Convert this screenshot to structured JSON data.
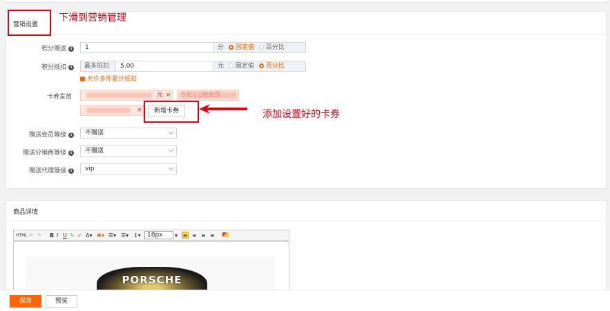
{
  "section": {
    "title": "营销设置",
    "annotation_scroll": "下滑到营销管理"
  },
  "points_gift": {
    "label": "积分赠送",
    "value": "1",
    "unit": "分",
    "opt_fixed": "固定值",
    "opt_percent": "百分比",
    "selected": "固定值"
  },
  "points_deduct": {
    "label": "积分抵扣",
    "prefix": "最多抵扣",
    "value": "5.00",
    "unit": "元",
    "opt_fixed": "固定值",
    "opt_percent": "百分比",
    "selected": "百分比",
    "checkbox_label": "允许多件累计抵扣"
  },
  "coupon": {
    "label": "卡券发放",
    "chip1_suffix": "元",
    "chip2_text": "5元 | 1级会员",
    "add_button": "新增卡券",
    "annotation": "添加设置好的卡券"
  },
  "gift_member_level": {
    "label": "赠送会员等级",
    "value": "不赠送"
  },
  "gift_distributor_level": {
    "label": "赠送分销商等级",
    "value": "不赠送"
  },
  "gift_agent_level": {
    "label": "赠送代理等级",
    "value": "vip"
  },
  "product_detail": {
    "title": "商品详情",
    "font_size": "18px",
    "image_text": "PORSCHE"
  },
  "footer": {
    "save": "保存",
    "preview": "预览"
  },
  "colors": {
    "accent": "#ff6600",
    "annotation": "#e60012"
  }
}
